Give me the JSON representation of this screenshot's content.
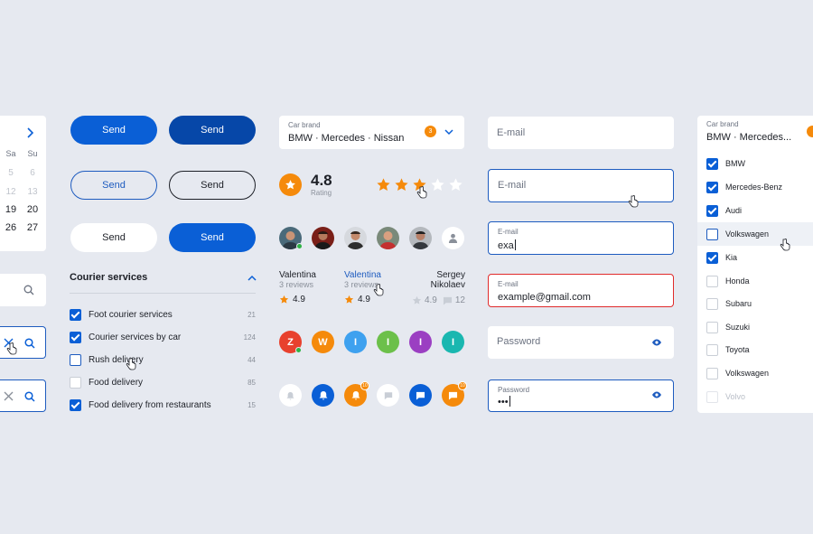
{
  "calendar": {
    "weekdays": [
      "Sa",
      "Su"
    ],
    "rows": [
      [
        "5",
        "6"
      ],
      [
        "12",
        "13"
      ],
      [
        "19",
        "20"
      ],
      [
        "26",
        "27"
      ]
    ]
  },
  "buttons": {
    "row1": [
      "Send",
      "Send"
    ],
    "row2": [
      "Send",
      "Send"
    ],
    "row3": [
      "Send",
      "Send"
    ]
  },
  "courier": {
    "title": "Courier services",
    "items": [
      {
        "label": "Foot courier services",
        "count": "21",
        "checked": true
      },
      {
        "label": "Courier services by car",
        "count": "124",
        "checked": true
      },
      {
        "label": "Rush delivery",
        "count": "44",
        "checked": false
      },
      {
        "label": "Food delivery",
        "count": "85",
        "checked": false
      },
      {
        "label": "Food delivery from restaurants",
        "count": "15",
        "checked": true
      }
    ]
  },
  "car_select": {
    "caption": "Car brand",
    "value": "BMW · Mercedes · Nissan",
    "badge": "3"
  },
  "rating": {
    "value": "4.8",
    "caption": "Rating",
    "stars_filled": 3,
    "stars_total": 5
  },
  "reviewers": [
    {
      "name": "Valentina",
      "sub": "3 reviews",
      "score": "4.9"
    },
    {
      "name": "Valentina",
      "sub": "3 reviews",
      "score": "4.9"
    },
    {
      "name": "Sergey Nikolaev",
      "score": "4.9",
      "comments": "12"
    }
  ],
  "letter_avatars": [
    {
      "letter": "Z",
      "color": "#e8412e"
    },
    {
      "letter": "W",
      "color": "#f58a0b"
    },
    {
      "letter": "I",
      "color": "#3ea1ef"
    },
    {
      "letter": "I",
      "color": "#6cc04a"
    },
    {
      "letter": "I",
      "color": "#9b3fc2"
    },
    {
      "letter": "I",
      "color": "#1ab7b0"
    }
  ],
  "notifications": {
    "badge1": "10",
    "badge2": "10"
  },
  "inputs": {
    "email_placeholder": "E-mail",
    "email_caption": "E-mail",
    "email_typing": "exa",
    "email_error_value": "example@gmail.com",
    "password_placeholder": "Password",
    "password_caption": "Password",
    "password_value": "•••"
  },
  "brand_list": {
    "caption": "Car brand",
    "value": "BMW · Mercedes...",
    "items": [
      {
        "label": "BMW",
        "checked": true
      },
      {
        "label": "Mercedes-Benz",
        "checked": true
      },
      {
        "label": "Audi",
        "checked": true
      },
      {
        "label": "Volkswagen",
        "checked": false
      },
      {
        "label": "Kia",
        "checked": true
      },
      {
        "label": "Honda",
        "checked": false
      },
      {
        "label": "Subaru",
        "checked": false
      },
      {
        "label": "Suzuki",
        "checked": false
      },
      {
        "label": "Toyota",
        "checked": false
      },
      {
        "label": "Volkswagen",
        "checked": false
      },
      {
        "label": "Volvo",
        "checked": false
      }
    ]
  },
  "colors": {
    "primary": "#0a5fd6",
    "primary_dark": "#0647a8",
    "accent": "#f58a0b",
    "error": "#e02b2b",
    "background": "#e6e9f0"
  }
}
